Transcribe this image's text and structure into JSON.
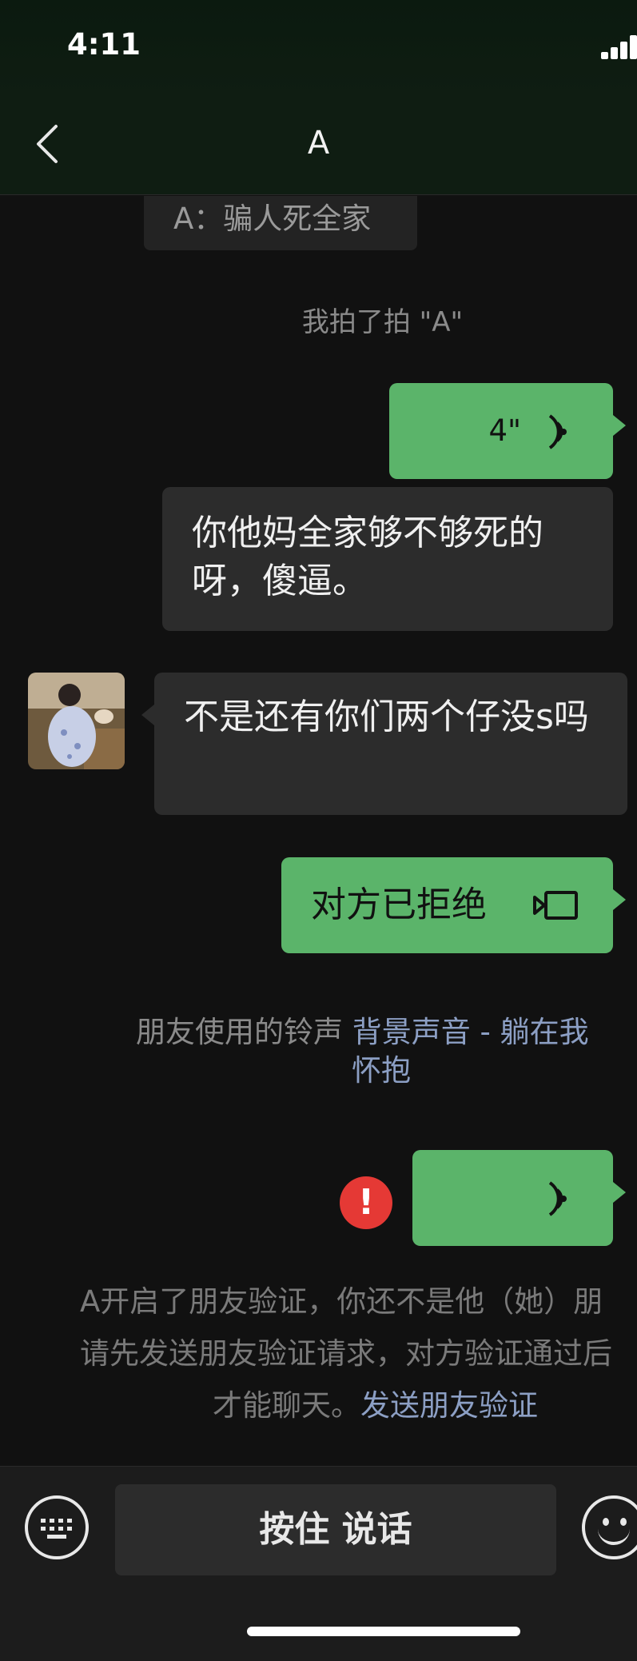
{
  "status_bar": {
    "time": "4:11"
  },
  "nav": {
    "title": "A"
  },
  "messages": {
    "quote_text": "A：骗人死全家",
    "pat_notice": "我拍了拍 \"A\"",
    "voice_1_duration": "4\"",
    "my_text": "你他妈全家够不够死的呀，傻逼。",
    "their_text": "不是还有你们两个仔没s吗",
    "call_status": "对方已拒绝",
    "ringtone_prefix": "朋友使用的铃声",
    "ringtone_song_line1": "背景声音 - 躺在我",
    "ringtone_song_line2": "怀抱",
    "fail_mark": "!"
  },
  "verify_notice": {
    "line1": "A开启了朋友验证，你还不是他（她）朋",
    "line2": "请先发送朋友验证请求，对方验证通过后",
    "line3_prefix": "才能聊天。",
    "link": "发送朋友验证"
  },
  "input_bar": {
    "hold_to_talk": "按住 说话"
  },
  "colors": {
    "bubble_green": "#5bb46a",
    "bubble_dark": "#2c2c2c",
    "link_blue": "#8c9fc4",
    "error_red": "#e53935"
  }
}
